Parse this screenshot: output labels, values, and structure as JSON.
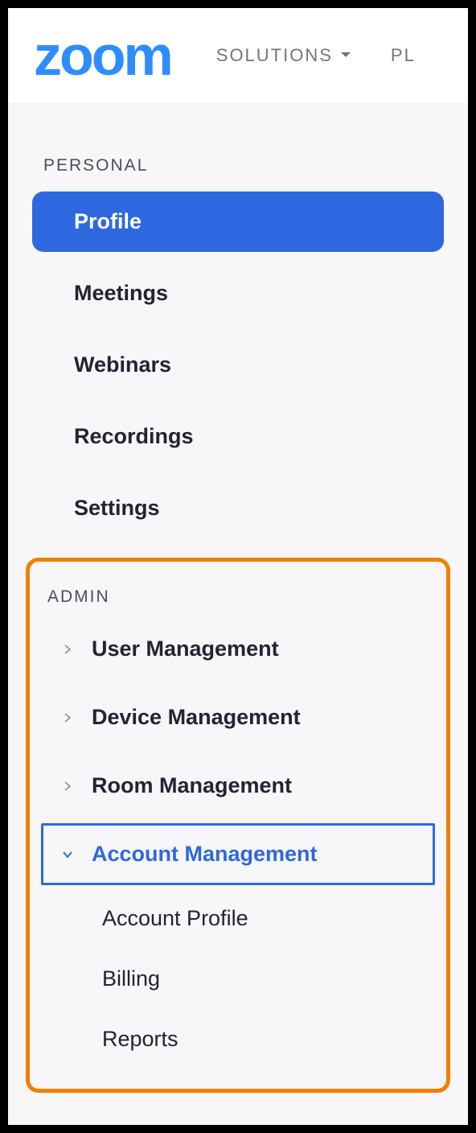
{
  "header": {
    "logo_text": "zoom",
    "nav": [
      {
        "label": "SOLUTIONS",
        "has_dropdown": true
      },
      {
        "label": "PL",
        "has_dropdown": false
      }
    ]
  },
  "sidebar": {
    "personal": {
      "heading": "PERSONAL",
      "items": [
        {
          "label": "Profile",
          "active": true
        },
        {
          "label": "Meetings",
          "active": false
        },
        {
          "label": "Webinars",
          "active": false
        },
        {
          "label": "Recordings",
          "active": false
        },
        {
          "label": "Settings",
          "active": false
        }
      ]
    },
    "admin": {
      "heading": "ADMIN",
      "items": [
        {
          "label": "User Management",
          "expanded": false
        },
        {
          "label": "Device Management",
          "expanded": false
        },
        {
          "label": "Room Management",
          "expanded": false
        },
        {
          "label": "Account Management",
          "expanded": true,
          "sub": [
            {
              "label": "Account Profile"
            },
            {
              "label": "Billing"
            },
            {
              "label": "Reports"
            }
          ]
        }
      ]
    }
  }
}
